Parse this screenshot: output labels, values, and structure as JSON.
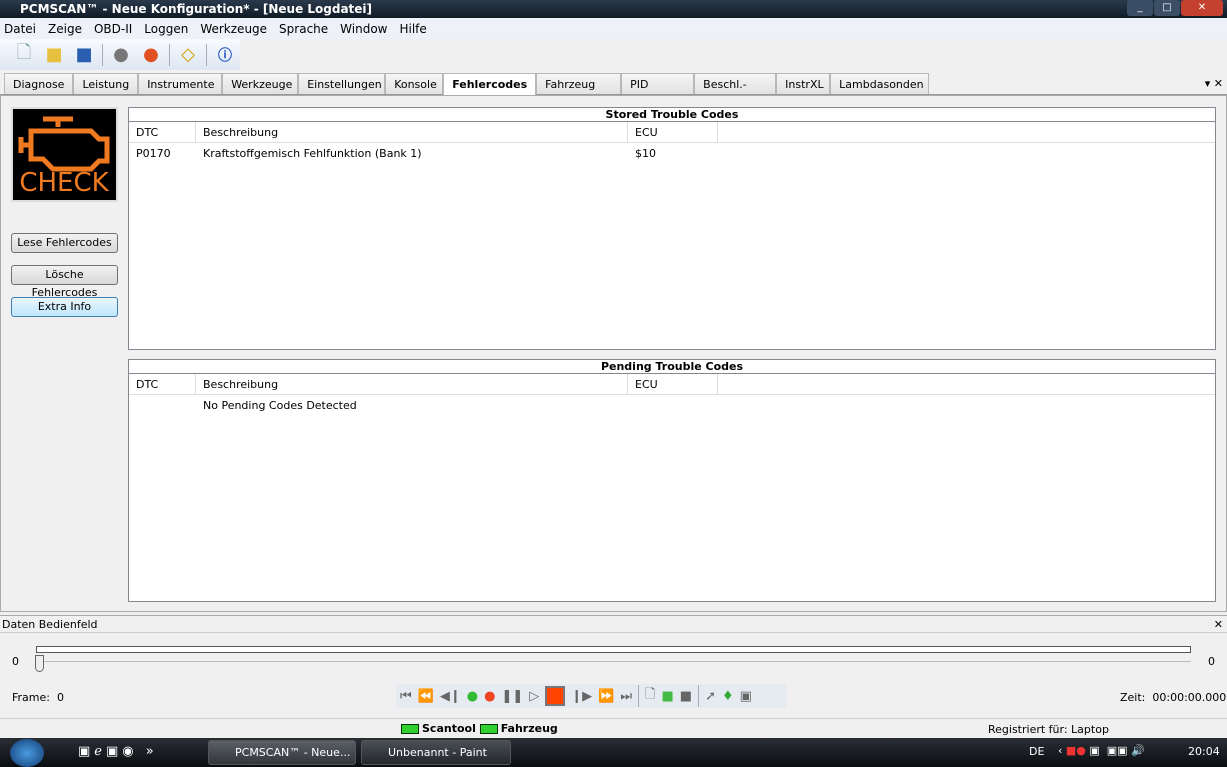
{
  "window": {
    "title": "PCMSCAN™ - Neue Konfiguration* - [Neue Logdatei]"
  },
  "menu": [
    "Datei",
    "Zeige",
    "OBD-II",
    "Loggen",
    "Werkzeuge",
    "Sprache",
    "Window",
    "Hilfe"
  ],
  "toolbar": [
    "new-file-icon",
    "open-folder-icon",
    "save-icon",
    "disconnect-icon",
    "connect-icon",
    "fit-icon",
    "info-icon"
  ],
  "tabs": [
    "Diagnose",
    "Leistung",
    "Instrumente",
    "Werkzeuge",
    "Einstellungen",
    "Konsole",
    "Fehlercodes",
    "Fahrzeug Info",
    "PID Konfig",
    "Beschl.-Lauf",
    "InstrXL",
    "Lambdasonden"
  ],
  "active_tab": "Fehlercodes",
  "check_label": "CHECK",
  "buttons": {
    "read": "Lese Fehlercodes",
    "clear": "Lösche Fehlercodes",
    "extra": "Extra Info"
  },
  "stored": {
    "title": "Stored Trouble Codes",
    "headers": [
      "DTC",
      "Beschreibung",
      "ECU"
    ],
    "rows": [
      [
        "P0170",
        "Kraftstoffgemisch Fehlfunktion (Bank 1)",
        "$10"
      ]
    ]
  },
  "pending": {
    "title": "Pending Trouble Codes",
    "headers": [
      "DTC",
      "Beschreibung",
      "ECU"
    ],
    "message": "No Pending Codes Detected"
  },
  "daten": {
    "title": "Daten Bedienfeld",
    "min": "0",
    "max": "0",
    "frame_label": "Frame:",
    "frame": "0",
    "zeit_label": "Zeit:",
    "zeit": "00:00:00.000",
    "slider_position": 0
  },
  "status": {
    "scantool": "Scantool",
    "fahrzeug": "Fahrzeug",
    "registered": "Registriert für: Laptop"
  },
  "taskbar": {
    "tasks": [
      "PCMSCAN™ - Neue...",
      "Unbenannt - Paint"
    ],
    "lang": "DE",
    "time": "20:04"
  }
}
